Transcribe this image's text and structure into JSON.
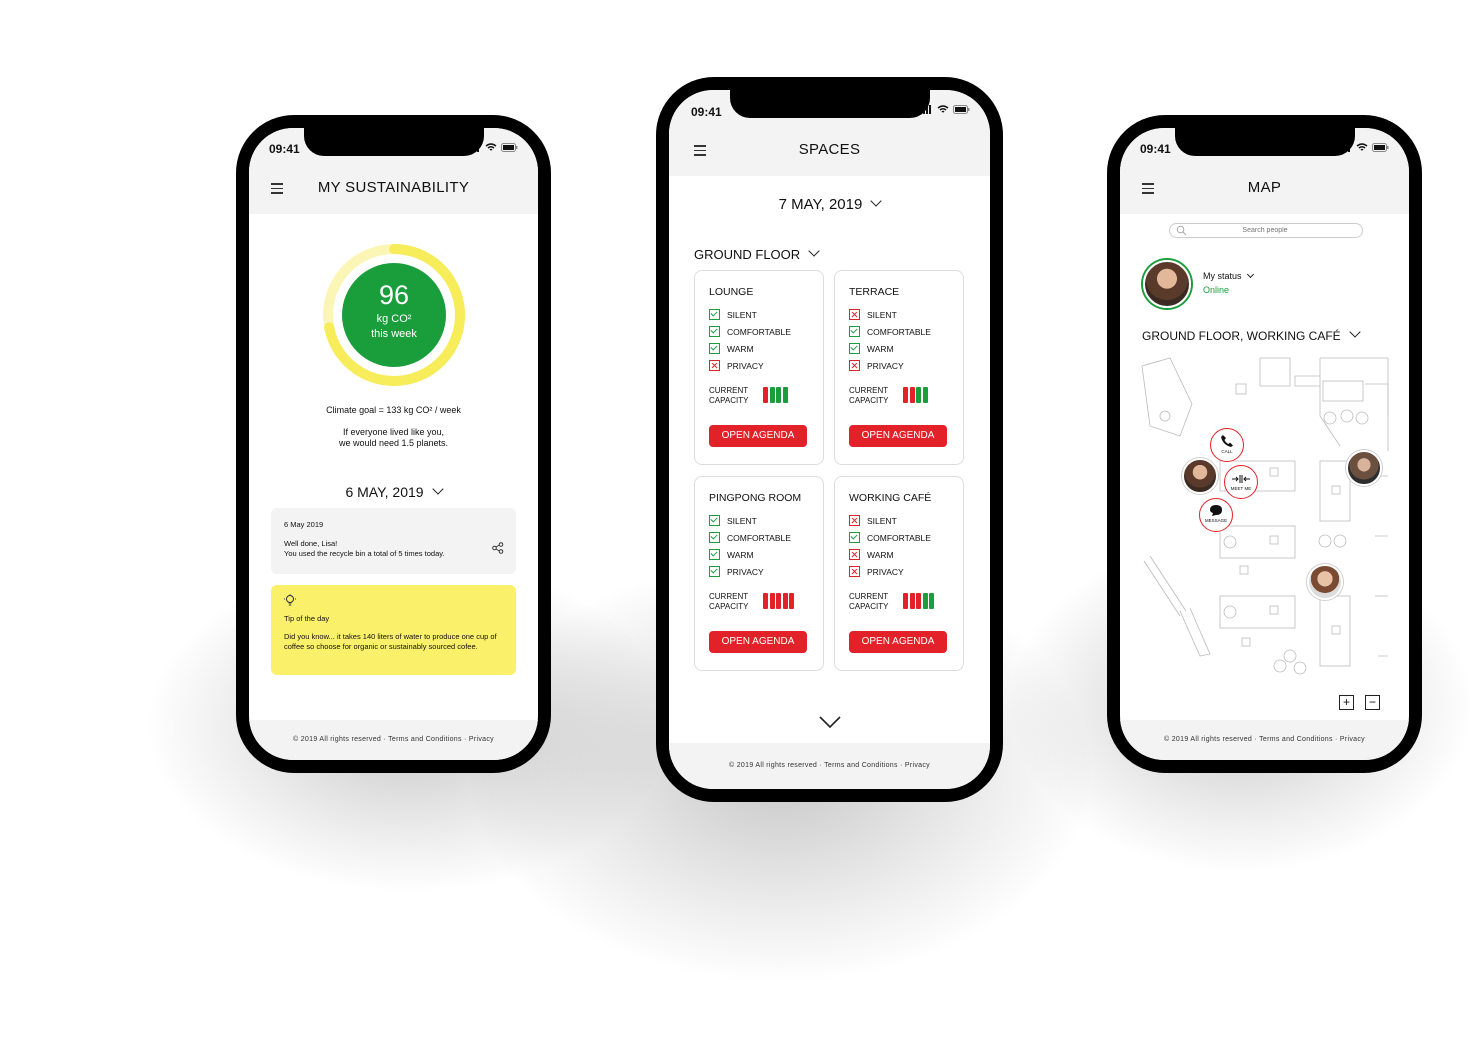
{
  "status_time": "09:41",
  "footer": "© 2019 All rights reserved · Terms and Conditions · Privacy",
  "sustainability": {
    "title": "MY SUSTAINABILITY",
    "gauge_value": "96",
    "gauge_unit": "kg CO²",
    "gauge_period": "this week",
    "gauge_fill_fraction": 0.72,
    "climate_goal": "Climate goal = 133 kg CO² / week",
    "planets_line1": "If everyone lived like you,",
    "planets_line2": "we would need 1.5 planets.",
    "date": "6 MAY, 2019",
    "notice": {
      "date": "6 May 2019",
      "line1": "Well done, Lisa!",
      "line2": "You used the recycle bin a total of 5 times today."
    },
    "tip": {
      "title": "Tip of the day",
      "text": "Did you know... it takes 140 liters of water to produce one cup of coffee so choose for organic or sustainably sourced cofee."
    }
  },
  "spaces": {
    "title": "SPACES",
    "date": "7 MAY, 2019",
    "floor": "GROUND FLOOR",
    "capacity_label_1": "CURRENT",
    "capacity_label_2": "CAPACITY",
    "open_agenda": "OPEN AGENDA",
    "cards": [
      {
        "name": "LOUNGE",
        "features": [
          [
            "SILENT",
            true
          ],
          [
            "COMFORTABLE",
            true
          ],
          [
            "WARM",
            true
          ],
          [
            "PRIVACY",
            false
          ]
        ],
        "capacity": [
          "red",
          "green",
          "green",
          "green"
        ]
      },
      {
        "name": "TERRACE",
        "features": [
          [
            "SILENT",
            false
          ],
          [
            "COMFORTABLE",
            true
          ],
          [
            "WARM",
            true
          ],
          [
            "PRIVACY",
            false
          ]
        ],
        "capacity": [
          "red",
          "red",
          "green",
          "green"
        ]
      },
      {
        "name": "PINGPONG ROOM",
        "features": [
          [
            "SILENT",
            true
          ],
          [
            "COMFORTABLE",
            true
          ],
          [
            "WARM",
            true
          ],
          [
            "PRIVACY",
            true
          ]
        ],
        "capacity": [
          "red",
          "red",
          "red",
          "red",
          "red"
        ]
      },
      {
        "name": "WORKING CAFÉ",
        "features": [
          [
            "SILENT",
            false
          ],
          [
            "COMFORTABLE",
            true
          ],
          [
            "WARM",
            false
          ],
          [
            "PRIVACY",
            false
          ]
        ],
        "capacity": [
          "red",
          "red",
          "red",
          "green",
          "green"
        ]
      }
    ]
  },
  "map": {
    "title": "MAP",
    "search_placeholder": "Search people",
    "status_label": "My status",
    "status_value": "Online",
    "location": "GROUND FLOOR, WORKING CAFÉ",
    "actions": {
      "call": "CALL",
      "meet": "MEET ME",
      "message": "MESSAGE"
    },
    "zoom_in": "+",
    "zoom_out": "−"
  },
  "colors": {
    "accent_red": "#e32128",
    "accent_green": "#1a9e3c",
    "tip_yellow": "#fbf06a",
    "gauge_yellow": "#f7ec5a"
  }
}
